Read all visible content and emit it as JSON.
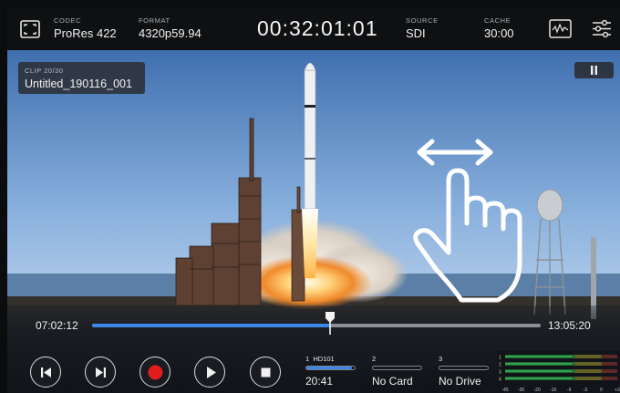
{
  "topbar": {
    "codec": {
      "label": "CODEC",
      "value": "ProRes 422"
    },
    "format": {
      "label": "FORMAT",
      "value": "4320p59.94"
    },
    "timecode": "00:32:01:01",
    "source": {
      "label": "SOURCE",
      "value": "SDI"
    },
    "cache": {
      "label": "CACHE",
      "value": "30:00"
    },
    "icons": [
      "fullscreen-icon",
      "waveform-scope-icon",
      "settings-sliders-icon"
    ]
  },
  "clip": {
    "counter": "CLIP 20/30",
    "name": "Untitled_190116_001"
  },
  "pause_icon": "pause-icon",
  "gesture": {
    "icon": "swipe-gesture-hand-icon"
  },
  "timeline": {
    "start_tc": "07:02:12",
    "end_tc": "13:05:20",
    "position": 0.53
  },
  "transport_buttons": [
    {
      "name": "skip-back-button",
      "icon": "skip-back-icon"
    },
    {
      "name": "skip-forward-button",
      "icon": "skip-forward-icon"
    },
    {
      "name": "record-button",
      "icon": "record-icon"
    },
    {
      "name": "play-button",
      "icon": "play-icon"
    },
    {
      "name": "stop-button",
      "icon": "stop-icon"
    }
  ],
  "media_slots": [
    {
      "number": "1",
      "card": "HD101",
      "status": "20:41",
      "fill": 0.95
    },
    {
      "number": "2",
      "card": "",
      "status": "No Card",
      "fill": 0
    },
    {
      "number": "3",
      "card": "",
      "status": "No Drive",
      "fill": 0
    }
  ],
  "audio_meters": {
    "channels": [
      "1",
      "2",
      "3",
      "4"
    ],
    "scale": [
      "-45",
      "-30",
      "-20",
      "-10",
      "-6",
      "-3",
      "0",
      "+3"
    ]
  },
  "colors": {
    "accent": "#3d87ea",
    "record": "#e21d1d",
    "meter_green": "#2ea84b"
  }
}
